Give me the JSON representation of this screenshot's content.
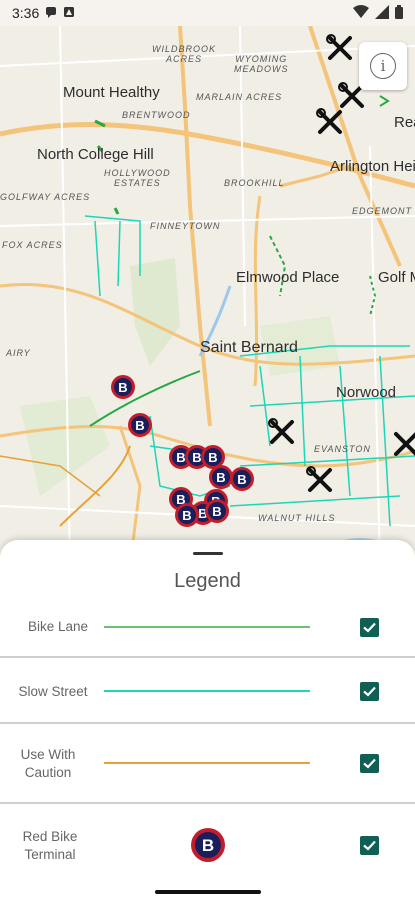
{
  "status_bar": {
    "time": "3:36"
  },
  "map": {
    "labels": {
      "mount_healthy": "Mount Healthy",
      "north_college_hill": "North College Hill",
      "arlington_heights": "Arlington Heig",
      "reading": "Rea",
      "elmwood_place": "Elmwood Place",
      "golf_manor": "Golf M",
      "saint_bernard": "Saint Bernard",
      "norwood": "Norwood",
      "wildbrook_acres": "WILDBROOK\nACRES",
      "wyoming_meadows": "WYOMING\nMEADOWS",
      "marlain_acres": "MARLAIN ACRES",
      "brentwood": "BRENTWOOD",
      "hollywood_estates": "HOLLYWOOD\nESTATES",
      "brookhill": "BROOKHILL",
      "golfway_acres": "GOLFWAY ACRES",
      "edgemont": "EDGEMONT",
      "finneytown": "FINNEYTOWN",
      "fox_acres": "FOX ACRES",
      "airy_ridge": "AIRY",
      "evanston": "EVANSTON",
      "walnut_hills": "WALNUT HILLS"
    },
    "terminal_letter": "B",
    "colors": {
      "bike_lane": "#27a845",
      "slow_street": "#1cd6b8",
      "caution": "#e6a13a",
      "terminal_red": "#c21d2b",
      "terminal_navy": "#1a1f5c"
    }
  },
  "legend": {
    "title": "Legend",
    "items": [
      {
        "label": "Bike Lane",
        "color": "#6dbf73",
        "checked": true
      },
      {
        "label": "Slow Street",
        "color": "#1cd6b8",
        "checked": true
      },
      {
        "label": "Use With Caution",
        "color": "#e6a13a",
        "checked": true
      },
      {
        "label": "Red Bike Terminal",
        "icon": "B",
        "checked": true
      }
    ]
  }
}
